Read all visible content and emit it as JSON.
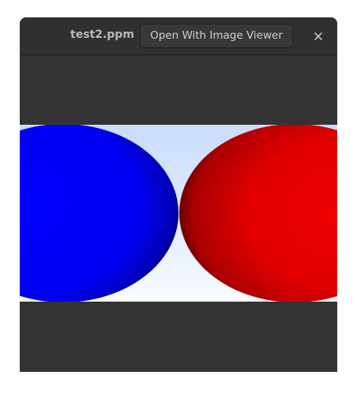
{
  "window": {
    "title": "test2.ppm",
    "open_with_label": "Open With Image Viewer",
    "close_icon": "close-icon"
  },
  "image": {
    "sky_top_color": "#c8dcfa",
    "sky_bottom_color": "#f8fbff",
    "left_sphere_color": "#0000ff",
    "right_sphere_color": "#e80000"
  }
}
